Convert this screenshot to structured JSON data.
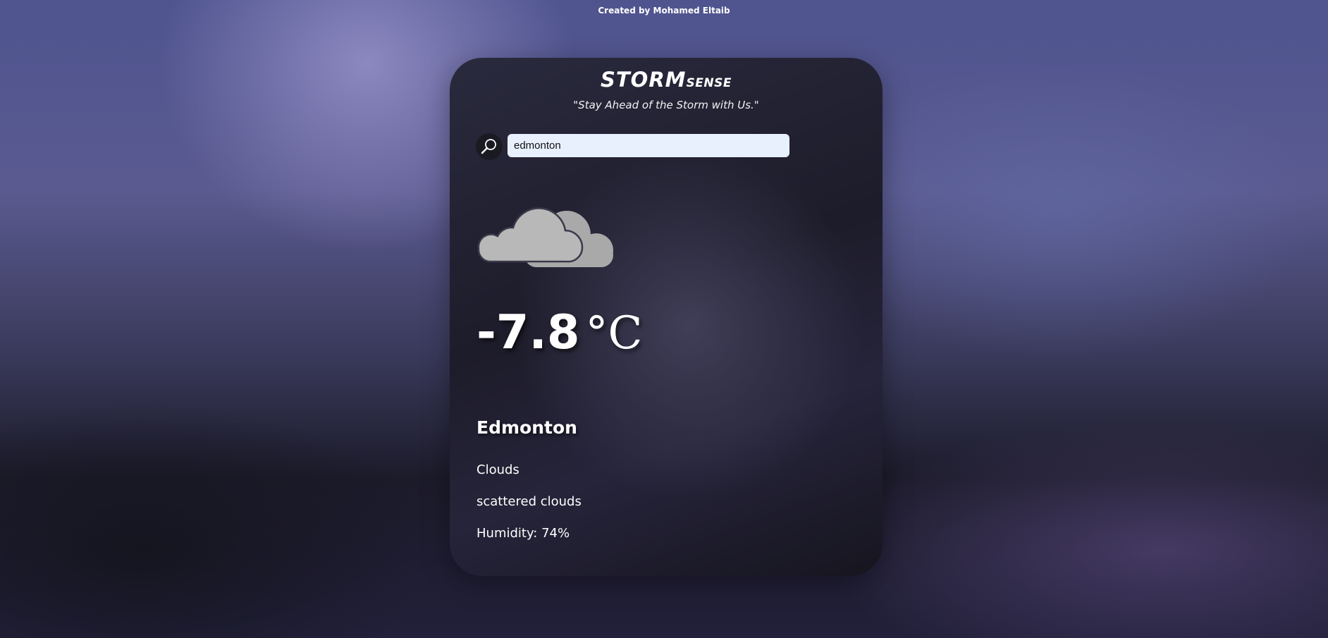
{
  "page": {
    "credit": "Created by Mohamed Eltaib"
  },
  "header": {
    "logo_primary": "STORM",
    "logo_secondary": "SENSE",
    "tagline": "\"Stay Ahead of the Storm with Us.\""
  },
  "search": {
    "value": "edmonton",
    "button_icon": "search-icon"
  },
  "weather": {
    "icon": "clouds-icon",
    "temperature": "-7.8",
    "unit": "°C",
    "city": "Edmonton",
    "condition": "Clouds",
    "description": "scattered clouds",
    "humidity": "Humidity: 74%"
  },
  "colors": {
    "card_bg": "#1d1c2a",
    "input_bg": "#e8f0fe",
    "cloud_front": "#b8b8b8",
    "cloud_back": "#a9a9a9"
  }
}
